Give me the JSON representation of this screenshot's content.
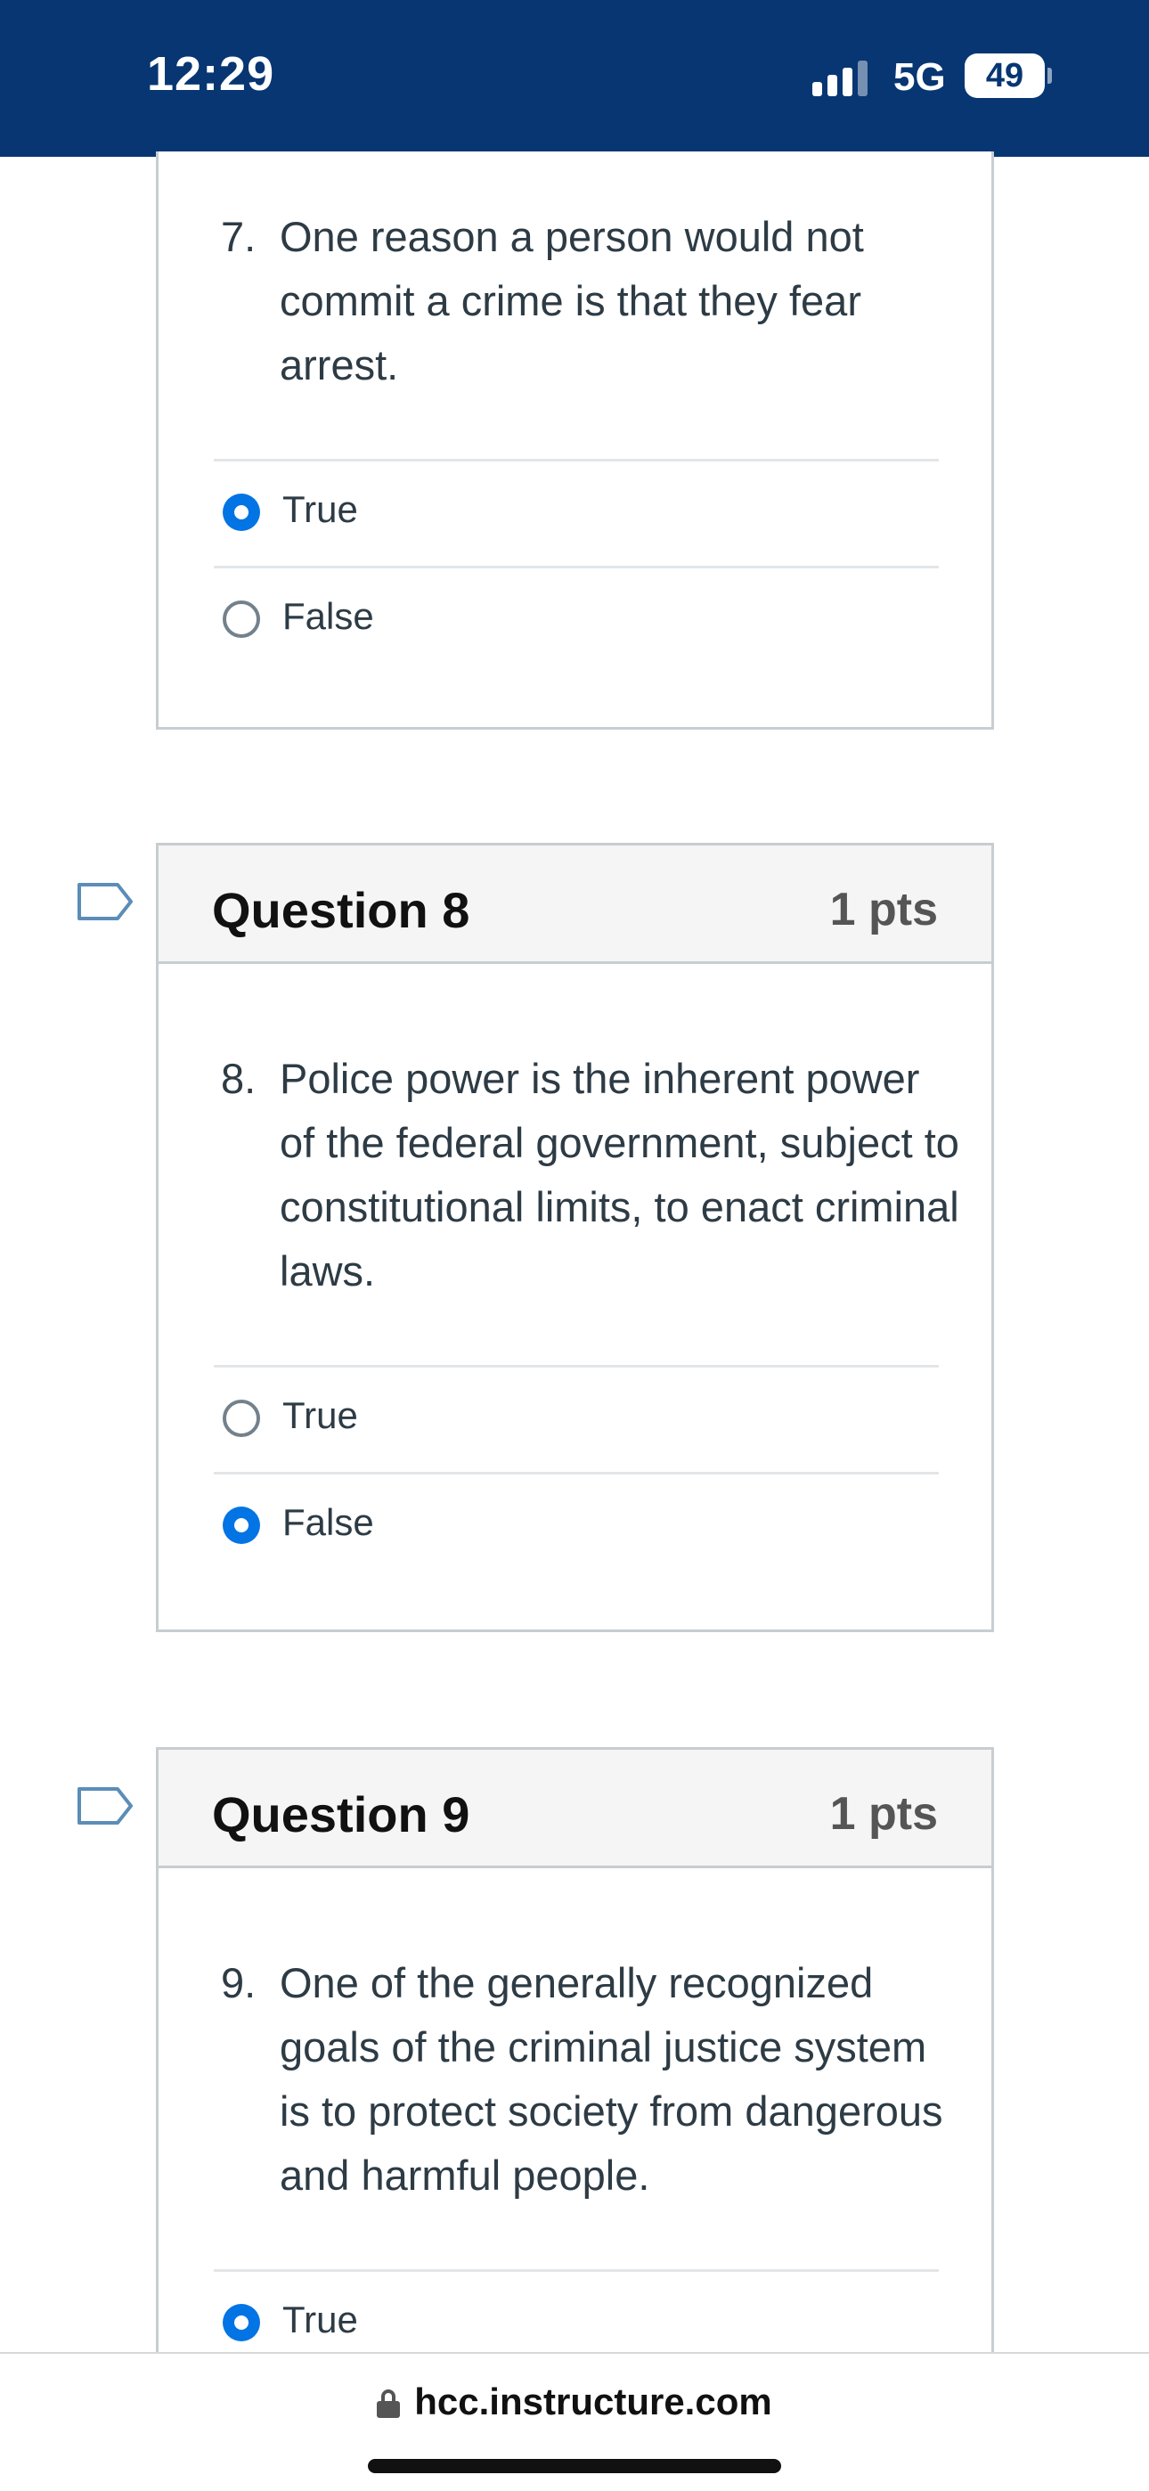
{
  "status_bar": {
    "time": "12:29",
    "network": "5G",
    "battery": "49",
    "colors": {
      "background": "#073673",
      "foreground": "#ffffff"
    }
  },
  "questions": [
    {
      "number": "7.",
      "text": "One reason a person would not commit a crime is that they fear arrest.",
      "answers": [
        {
          "label": "True",
          "selected": true
        },
        {
          "label": "False",
          "selected": false
        }
      ]
    },
    {
      "title": "Question 8",
      "points": "1 pts",
      "number": "8.",
      "text": "Police power is the inherent power of the federal government, subject to constitutional limits, to enact criminal laws.",
      "answers": [
        {
          "label": "True",
          "selected": false
        },
        {
          "label": "False",
          "selected": true
        }
      ]
    },
    {
      "title": "Question 9",
      "points": "1 pts",
      "number": "9.",
      "text": "One of the generally recognized goals of the criminal justice system is to protect society from dangerous and harmful people.",
      "answers": [
        {
          "label": "True",
          "selected": true
        }
      ]
    }
  ],
  "browser": {
    "url": "hcc.instructure.com",
    "lock_icon": "lock-icon"
  },
  "colors": {
    "selected_radio": "#0374e4",
    "card_border": "#c7cdd1",
    "header_bg": "#f5f5f5",
    "flag_outline": "#5b8db8"
  }
}
